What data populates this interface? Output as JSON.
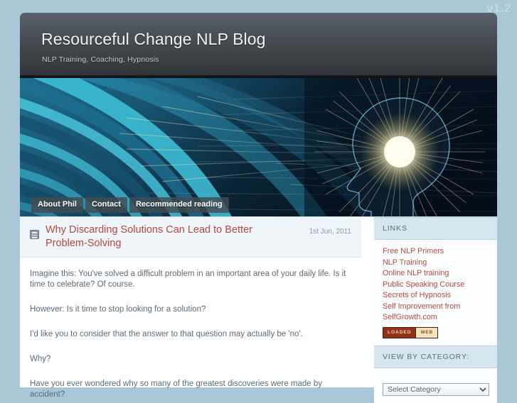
{
  "watermark": "v1.2",
  "header": {
    "title": "Resourceful Change NLP Blog",
    "tagline": "NLP Training, Coaching, Hypnosis"
  },
  "nav": {
    "tabs": [
      {
        "label": "About Phil"
      },
      {
        "label": "Contact"
      },
      {
        "label": "Recommended reading"
      }
    ]
  },
  "banner": {
    "description": "Abstract blue swirl with glowing head silhouette",
    "colors": {
      "deep": "#061826",
      "cyan": "#2aa8c4",
      "teal": "#1d7f9e",
      "dark": "#0a2437",
      "glow": "#f5f0c0"
    }
  },
  "post": {
    "icon": "article-icon",
    "title": "Why Discarding Solutions Can Lead to Better Problem-Solving",
    "date": "1st Jun, 2011",
    "paragraphs": [
      "Imagine this: You've solved a difficult problem in an important area of your daily life. Is it time to celebrate? Of course.",
      "However: Is it time to stop looking for a solution?",
      "I'd like you to consider that the answer to that question may actually be 'no'.",
      "Why?",
      "Have you ever wondered why so many of the greatest discoveries were made by accident?"
    ]
  },
  "sidebar": {
    "links_widget": {
      "title": "LINKS",
      "items": [
        {
          "label": "Free NLP Primers"
        },
        {
          "label": "NLP Training"
        },
        {
          "label": "Online NLP training"
        },
        {
          "label": "Public Speaking Course"
        },
        {
          "label": "Secrets of Hypnosis"
        },
        {
          "label": "Self Improvement from"
        },
        {
          "label": "SelfGrowth.com"
        }
      ],
      "badge": {
        "left": "LOADED",
        "right": "WEB"
      }
    },
    "category_widget": {
      "title": "VIEW BY CATEGORY:",
      "selected": "Select Category"
    }
  },
  "colors": {
    "page_background": "#a9c7d6",
    "link": "#b14a42",
    "body_text": "#5c6b76",
    "widget_head_bg": "#d6e6ef"
  }
}
